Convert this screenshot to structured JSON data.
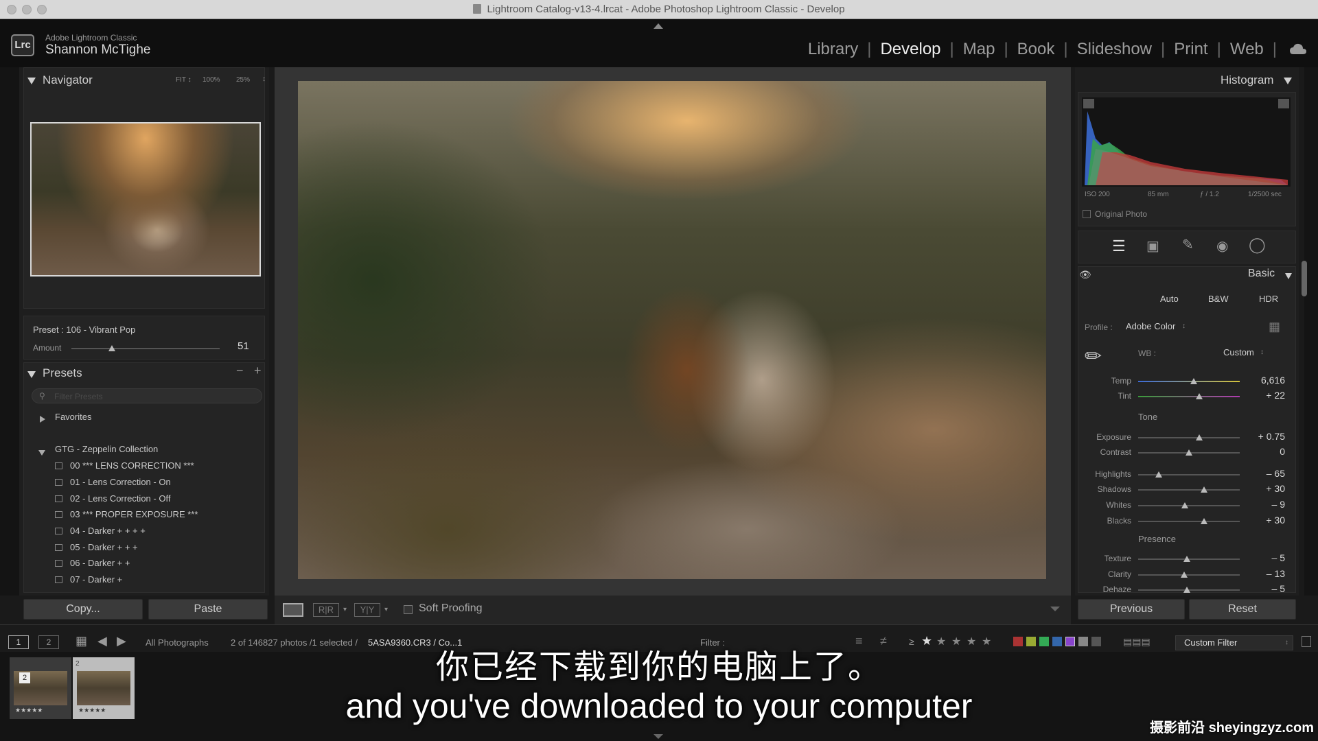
{
  "window": {
    "title": "Lightroom Catalog-v13-4.lrcat - Adobe Photoshop Lightroom Classic - Develop"
  },
  "header": {
    "logo": "Lrc",
    "app_name": "Adobe Lightroom Classic",
    "user_name": "Shannon McTighe",
    "modules": [
      "Library",
      "Develop",
      "Map",
      "Book",
      "Slideshow",
      "Print",
      "Web"
    ],
    "active_module": "Develop"
  },
  "navigator": {
    "title": "Navigator",
    "zoom_options": [
      "FIT ↕",
      "100%",
      "25%"
    ]
  },
  "preset_amount": {
    "preset_label": "Preset : 106 - Vibrant Pop",
    "amount_label": "Amount",
    "amount_value": "51"
  },
  "presets": {
    "title": "Presets",
    "minus": "−",
    "plus": "+",
    "filter_placeholder": "Filter Presets",
    "favorites": "Favorites",
    "collection": "GTG - Zeppelin Collection",
    "items": [
      "00 *** LENS CORRECTION ***",
      "01 - Lens Correction - On",
      "02 - Lens Correction - Off",
      "03 *** PROPER EXPOSURE ***",
      "04 - Darker + + + +",
      "05 - Darker + + +",
      "06 - Darker + +",
      "07 - Darker +"
    ]
  },
  "left_buttons": {
    "copy": "Copy...",
    "paste": "Paste"
  },
  "toolbar": {
    "soft_proofing": "Soft Proofing"
  },
  "histogram": {
    "title": "Histogram",
    "iso": "ISO 200",
    "focal": "85 mm",
    "aperture": "ƒ / 1.2",
    "shutter": "1/2500 sec",
    "original_photo": "Original Photo"
  },
  "basic": {
    "title": "Basic",
    "auto": "Auto",
    "bw": "B&W",
    "hdr": "HDR",
    "profile_label": "Profile :",
    "profile_value": "Adobe Color",
    "wb_label": "WB :",
    "wb_value": "Custom",
    "tone_label": "Tone",
    "presence_label": "Presence",
    "sliders": [
      {
        "label": "Temp",
        "value": "6,616",
        "pos": 0.55
      },
      {
        "label": "Tint",
        "value": "+ 22",
        "pos": 0.6
      },
      {
        "label": "Exposure",
        "value": "+ 0.75",
        "pos": 0.6
      },
      {
        "label": "Contrast",
        "value": "0",
        "pos": 0.5
      },
      {
        "label": "Highlights",
        "value": "– 65",
        "pos": 0.2
      },
      {
        "label": "Shadows",
        "value": "+ 30",
        "pos": 0.65
      },
      {
        "label": "Whites",
        "value": "– 9",
        "pos": 0.46
      },
      {
        "label": "Blacks",
        "value": "+ 30",
        "pos": 0.65
      },
      {
        "label": "Texture",
        "value": "– 5",
        "pos": 0.48
      },
      {
        "label": "Clarity",
        "value": "– 13",
        "pos": 0.45
      },
      {
        "label": "Dehaze",
        "value": "– 5",
        "pos": 0.48
      }
    ]
  },
  "right_buttons": {
    "previous": "Previous",
    "reset": "Reset"
  },
  "filmbar": {
    "page1": "1",
    "page2": "2",
    "source": "All Photographs",
    "count": "2 of 146827 photos /1 selected /",
    "filename": "5ASA9360.CR3 / Co...1",
    "filter_label": "Filter :",
    "custom_filter": "Custom Filter"
  },
  "filmstrip": {
    "thumbs": [
      {
        "badge": "2",
        "stars": "★★★★★"
      },
      {
        "badge": "2",
        "stars": "★★★★★"
      }
    ],
    "colors": [
      "#c44",
      "#cc4",
      "#4a4",
      "#48c",
      "#a4c"
    ]
  },
  "subtitles": {
    "cn": "你已经下载到你的电脑上了。",
    "en": "and you've downloaded to your computer"
  },
  "watermark": "摄影前沿 sheyingzyz.com"
}
